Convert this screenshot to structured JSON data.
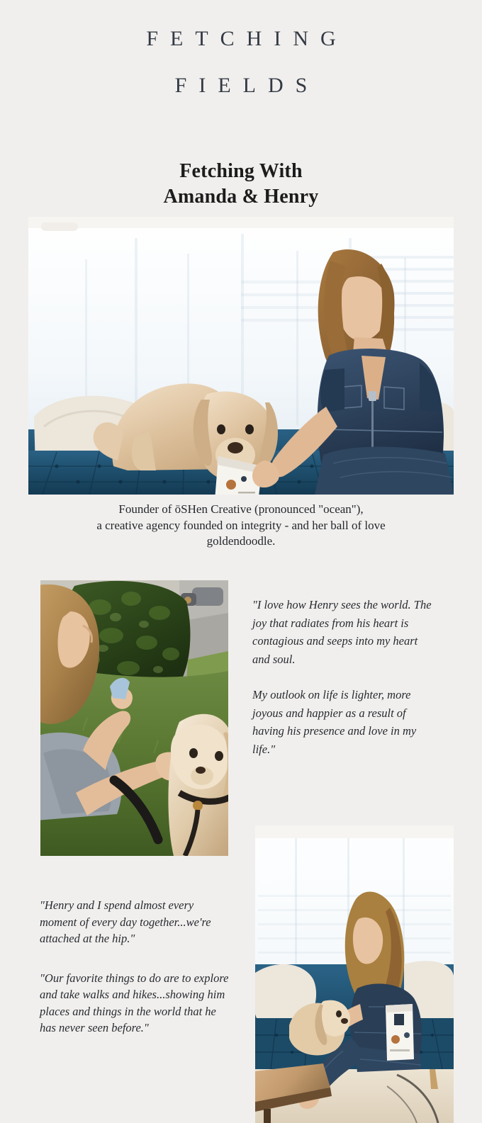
{
  "brand": {
    "line1": "FETCHING",
    "line2": "FIELDS",
    "color": "#333a45"
  },
  "article": {
    "title_line1": "Fetching With",
    "title_line2": "Amanda & Henry",
    "title_color": "#1c1c1c"
  },
  "hero": {
    "alt": "Woman in denim jumpsuit sitting on a blue velvet tufted sofa feeding a goldendoodle a treat from a bag",
    "caption_line1": "Founder of ōSHen Creative (pronounced \"ocean\"),",
    "caption_line2": "a creative agency founded on integrity - and her ball of love",
    "caption_line3": "goldendoodle."
  },
  "quotes": {
    "right": [
      "\"I love how Henry sees the world. The joy that radiates from his heart is contagious and seeps into my heart and soul.",
      "My outlook on life is lighter, more joyous and happier as a result of having his presence and love in my life.\""
    ],
    "left": [
      "\"Henry and I spend almost every moment of every day together...we're attached at the hip.\"",
      "\"Our favorite things to do are to explore and take walks and hikes...showing him places and things in the world that he has never seen before.\""
    ]
  },
  "photos": {
    "outdoor_alt": "Woman kneeling on grass in front of a green hedge feeding a treat to a goldendoodle on a leash",
    "livingroom_alt": "Woman sitting barefoot on a blue velvet tufted sofa with a goldendoodle and a treat bag, wooden coffee table in foreground"
  },
  "palette": {
    "background": "#f1efed",
    "sofa_blue": "#1f4f6b",
    "dog_cream": "#d9bd97",
    "grass_green": "#5d7a3a",
    "hedge_dark": "#2e4420",
    "denim": "#2b3c52",
    "text_dark": "#262a30"
  }
}
